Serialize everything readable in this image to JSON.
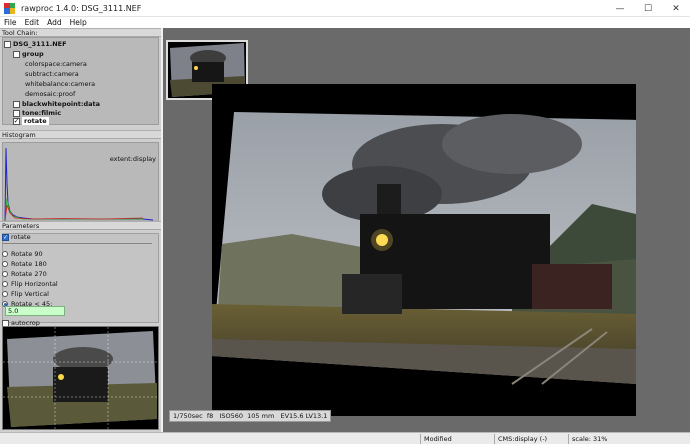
{
  "window": {
    "title": "rawproc 1.4.0: DSG_3111.NEF",
    "controls": [
      "—",
      "☐",
      "✕"
    ]
  },
  "menu": [
    "File",
    "Edit",
    "Add",
    "Help"
  ],
  "toolchain": {
    "header": "Tool Chain:",
    "items": [
      {
        "label": "DSG_3111.NEF",
        "checked": false
      },
      {
        "label": "group",
        "checked": false
      },
      {
        "label": "colorspace:camera"
      },
      {
        "label": "subtract:camera"
      },
      {
        "label": "whitebalance:camera"
      },
      {
        "label": "demosaic:proof"
      },
      {
        "label": "blackwhitepoint:data",
        "checked": false
      },
      {
        "label": "tone:filmic",
        "checked": false
      },
      {
        "label": "rotate",
        "checked": true
      }
    ]
  },
  "histogram": {
    "header": "Histogram",
    "label": "extent:display"
  },
  "parameters": {
    "header": "Parameters",
    "tool": "rotate",
    "options": [
      "Rotate 90",
      "Rotate 180",
      "Rotate 270",
      "Flip Horizontal",
      "Flip Vertical",
      "Rotate < 45:"
    ],
    "selected": "Rotate < 45:",
    "angle_value": "5.0",
    "autocrop_label": "autocrop",
    "autocrop": false
  },
  "image_info": "1/750sec  f8   ISO560  105 mm   EV15.6 LV13.1",
  "status": {
    "modified": "Modified",
    "cms": "CMS:display (-)",
    "scale": "scale: 31%"
  },
  "colors": {
    "panel_bg": "#b9b9b9",
    "main_bg": "#6a6a6a",
    "hist_blue": "#2222cc",
    "hist_red": "#cc2222",
    "input_bg": "#c9ffc9"
  }
}
